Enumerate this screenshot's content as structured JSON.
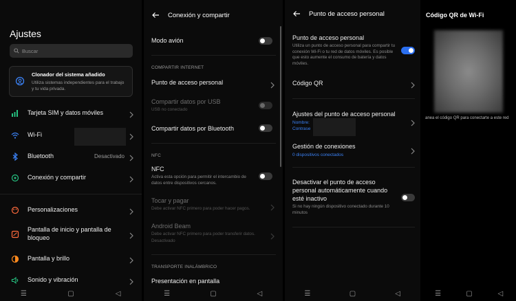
{
  "screen1": {
    "title": "Ajustes",
    "search_placeholder": "Buscar",
    "card": {
      "title": "Clonador del sistema añadido",
      "desc": "Utiliza sistemas independientes para el trabajo y tu vida privada."
    },
    "items": [
      {
        "label": "Tarjeta SIM y datos móviles",
        "icon": "sim-icon",
        "value": ""
      },
      {
        "label": "Wi-Fi",
        "icon": "wifi-icon",
        "value": ""
      },
      {
        "label": "Bluetooth",
        "icon": "bluetooth-icon",
        "value": "Desactivado"
      },
      {
        "label": "Conexión y compartir",
        "icon": "connection-icon",
        "value": ""
      },
      {
        "label": "Personalizaciones",
        "icon": "palette-icon",
        "value": ""
      },
      {
        "label": "Pantalla de inicio y pantalla de bloqueo",
        "icon": "home-screen-icon",
        "value": ""
      },
      {
        "label": "Pantalla y brillo",
        "icon": "brightness-icon",
        "value": ""
      },
      {
        "label": "Sonido y vibración",
        "icon": "sound-icon",
        "value": ""
      }
    ],
    "colors": {
      "sim": "#26c281",
      "wifi": "#3b82f6",
      "bluetooth": "#3b82f6",
      "connection": "#26c281",
      "palette": "#ff6b3d",
      "home": "#ff6b3d",
      "brightness": "#ff8a1e",
      "sound": "#26c281"
    }
  },
  "screen2": {
    "title": "Conexión y compartir",
    "airplane": "Modo avión",
    "section_internet": "COMPARTIR INTERNET",
    "hotspot": "Punto de acceso personal",
    "usb": "Compartir datos por USB",
    "usb_sub": "USB no conectado",
    "bt_share": "Compartir datos por Bluetooth",
    "section_nfc": "NFC",
    "nfc": "NFC",
    "nfc_sub": "Activa esta opción para permitir el intercambio de datos entre dispositivos cercanos.",
    "tap_pay": "Tocar y pagar",
    "tap_pay_sub": "Debe activar NFC primero para poder hacer pagos.",
    "beam": "Android Beam",
    "beam_sub": "Debe activar NFC primero para poder transferir datos.",
    "beam_sub2": "Desactivado",
    "section_wireless": "TRANSPORTE INALÁMBRICO",
    "screen_present": "Presentación en pantalla"
  },
  "screen3": {
    "title": "Punto de acceso personal",
    "hotspot": "Punto de acceso personal",
    "hotspot_sub": "Utiliza un punto de acceso personal para compartir tu conexión Wi-Fi o tu red de datos móviles. Es posible que esto aumente el consumo de batería y datos móviles.",
    "qr": "Código QR",
    "settings": "Ajustes del punto de acceso personal",
    "settings_name": "Nombre: ",
    "settings_pass": "Contrase",
    "manage": "Gestión de conexiones",
    "manage_sub": "0 dispositivos conectados",
    "auto_off": "Desactivar el punto de acceso personal automáticamente cuando esté inactivo",
    "auto_off_sub": "Si no hay ningún dispositivo conectado durante 10 minutos"
  },
  "screen4": {
    "title": "Código QR de Wi-Fi",
    "caption": "anea el código QR para conectarte a este red"
  },
  "navbar": {
    "menu": "☰",
    "home": "▢",
    "back": "◁"
  }
}
